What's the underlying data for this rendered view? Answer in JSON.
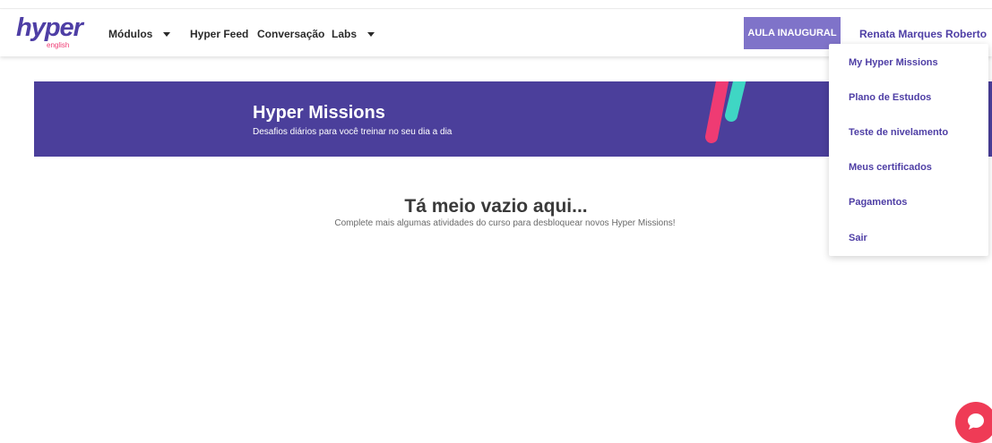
{
  "brand": {
    "name": "hyper",
    "sub": "english"
  },
  "nav": {
    "items": [
      {
        "label": "Módulos",
        "has_dropdown": true
      },
      {
        "label": "Hyper Feed",
        "has_dropdown": false
      },
      {
        "label": "Conversação",
        "has_dropdown": false
      },
      {
        "label": "Labs",
        "has_dropdown": true
      }
    ],
    "cta_label": "AULA INAUGURAL",
    "user_name": "Renata Marques Roberto"
  },
  "banner": {
    "title": "Hyper Missions",
    "subtitle": "Desafios diários para você treinar no seu dia a dia"
  },
  "empty_state": {
    "title": "Tá meio vazio aqui...",
    "message": "Complete mais algumas atividades do curso para desbloquear novos Hyper Missions!"
  },
  "user_menu": {
    "items": [
      "My Hyper Missions",
      "Plano de Estudos",
      "Teste de nivelamento",
      "Meus certificados",
      "Pagamentos",
      "Sair"
    ]
  },
  "colors": {
    "brand_purple": "#4e3ea5",
    "banner_bg": "#4b3f9b",
    "cta_bg": "#7f73c9",
    "accent_pink": "#ef3b73",
    "accent_teal": "#3fd6c4",
    "chat_bg": "#ef3b56"
  },
  "icons": {
    "chat": "chat-bubble-icon",
    "dropdown": "caret-down-icon"
  }
}
